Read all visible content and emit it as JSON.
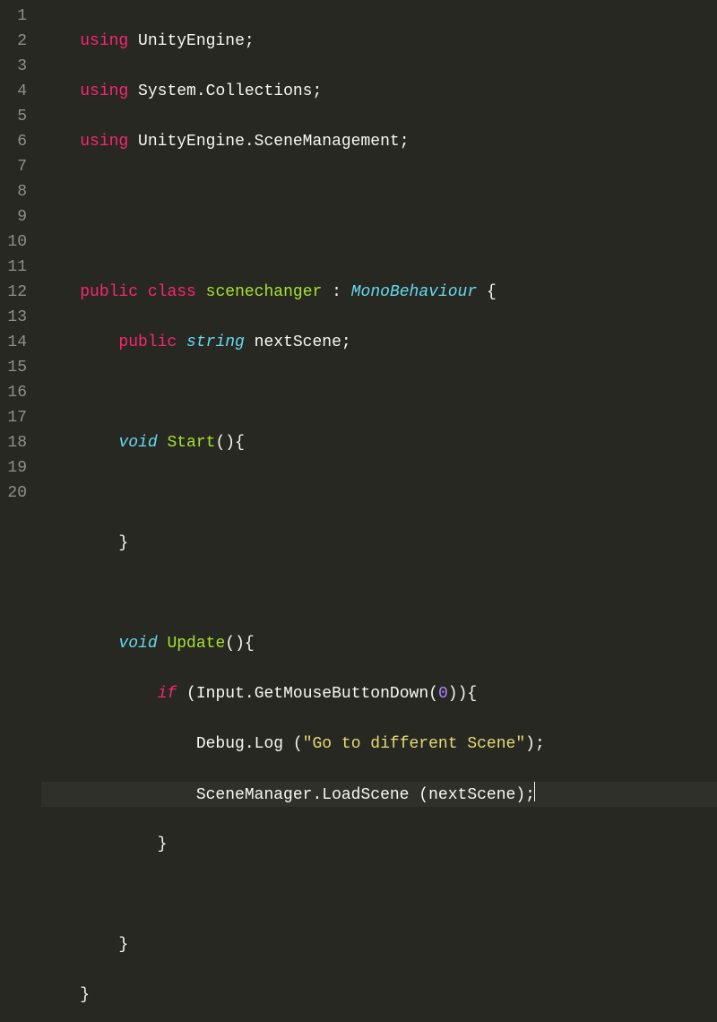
{
  "gutter": {
    "start": 1,
    "end": 20
  },
  "tokens": {
    "using": "using",
    "public": "public",
    "class": "class",
    "void": "void",
    "string": "string",
    "if": "if"
  },
  "lines": {
    "l1_ns": "UnityEngine",
    "l2_ns": "System.Collections",
    "l3_ns": "UnityEngine.SceneManagement",
    "l6_classname": "scenechanger",
    "l6_base": "MonoBehaviour",
    "l7_field": "nextScene",
    "l9_method": "Start",
    "l13_method": "Update",
    "l14_call1": "Input",
    "l14_call2": "GetMouseButtonDown",
    "l14_arg": "0",
    "l15_call1": "Debug",
    "l15_call2": "Log",
    "l15_str": "\"Go to different Scene\"",
    "l16_call1": "SceneManager",
    "l16_call2": "LoadScene",
    "l16_arg": "nextScene"
  },
  "punct": {
    "semi": ";",
    "colon": ":",
    "obrace": "{",
    "cbrace": "}",
    "oparen": "(",
    "cparen": ")",
    "dot": "."
  },
  "colors": {
    "bg": "#272822",
    "fg": "#f8f8f2",
    "keyword": "#f92672",
    "type": "#66d9ef",
    "func": "#a6e22e",
    "string": "#e6db74",
    "number": "#ae81ff",
    "gutter": "#8f908a"
  },
  "active_line": 16
}
